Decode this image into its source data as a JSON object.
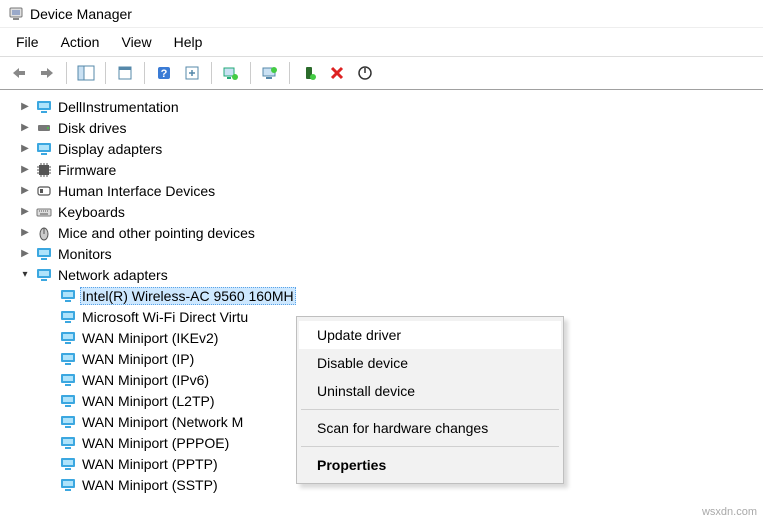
{
  "window": {
    "title": "Device Manager"
  },
  "menu": {
    "file": "File",
    "action": "Action",
    "view": "View",
    "help": "Help"
  },
  "tree": {
    "l0": "DellInstrumentation",
    "l1": "Disk drives",
    "l2": "Display adapters",
    "l3": "Firmware",
    "l4": "Human Interface Devices",
    "l5": "Keyboards",
    "l6": "Mice and other pointing devices",
    "l7": "Monitors",
    "l8": "Network adapters",
    "na0": "Intel(R) Wireless-AC 9560 160MH",
    "na1": "Microsoft Wi-Fi Direct Virtu",
    "na2": "WAN Miniport (IKEv2)",
    "na3": "WAN Miniport (IP)",
    "na4": "WAN Miniport (IPv6)",
    "na5": "WAN Miniport (L2TP)",
    "na6": "WAN Miniport (Network M",
    "na7": "WAN Miniport (PPPOE)",
    "na8": "WAN Miniport (PPTP)",
    "na9": "WAN Miniport (SSTP)"
  },
  "context_menu": {
    "update": "Update driver",
    "disable": "Disable device",
    "uninstall": "Uninstall device",
    "scan": "Scan for hardware changes",
    "properties": "Properties"
  },
  "watermark": "wsxdn.com"
}
